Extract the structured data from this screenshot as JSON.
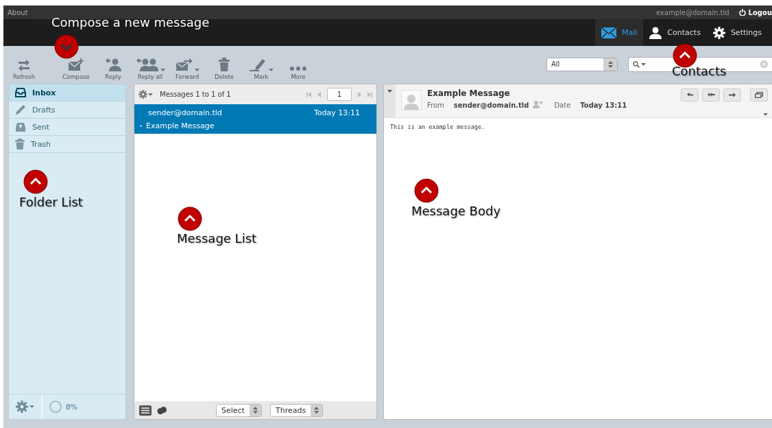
{
  "top_bar": {
    "about": "About",
    "user": "example@domain.tld",
    "logout": "Logou"
  },
  "tasks": [
    {
      "label": "Mail",
      "kind": "mail",
      "selected": true
    },
    {
      "label": "Contacts",
      "kind": "contacts",
      "selected": false
    },
    {
      "label": "Settings",
      "kind": "settings",
      "selected": false
    }
  ],
  "toolbar": [
    {
      "label": "Refresh",
      "kind": "refresh",
      "dropdown": false
    },
    {
      "label": "Compose",
      "kind": "compose",
      "dropdown": false
    },
    {
      "label": "Reply",
      "kind": "reply",
      "dropdown": false
    },
    {
      "label": "Reply all",
      "kind": "replyall",
      "dropdown": true
    },
    {
      "label": "Forward",
      "kind": "forward",
      "dropdown": true
    },
    {
      "label": "Delete",
      "kind": "delete",
      "dropdown": false
    },
    {
      "label": "Mark",
      "kind": "mark",
      "dropdown": true
    },
    {
      "label": "More",
      "kind": "more",
      "dropdown": false
    }
  ],
  "filter": {
    "value": "All"
  },
  "folders": [
    {
      "label": "Inbox",
      "kind": "inbox",
      "selected": true
    },
    {
      "label": "Drafts",
      "kind": "drafts",
      "selected": false
    },
    {
      "label": "Sent",
      "kind": "sent",
      "selected": false
    },
    {
      "label": "Trash",
      "kind": "trash",
      "selected": false
    }
  ],
  "folder_footer": {
    "quota": "0%"
  },
  "message_list": {
    "header": "Messages 1 to 1 of 1",
    "page": "1",
    "messages": [
      {
        "from": "sender@domain.tld",
        "date": "Today 13:11",
        "subject": "Example Message",
        "selected": true
      }
    ],
    "select": "Select",
    "threading": "Threads"
  },
  "message": {
    "subject": "Example Message",
    "from_label": "From",
    "from": "sender@domain.tld",
    "date_label": "Date",
    "date": "Today 13:11",
    "body": "This is an example message."
  },
  "callouts": [
    {
      "label": "Compose a new message",
      "kind": "down"
    },
    {
      "label": "Contacts",
      "kind": "up"
    },
    {
      "label": "Folder List",
      "kind": "up"
    },
    {
      "label": "Message List",
      "kind": "up"
    },
    {
      "label": "Message Body",
      "kind": "up"
    }
  ]
}
